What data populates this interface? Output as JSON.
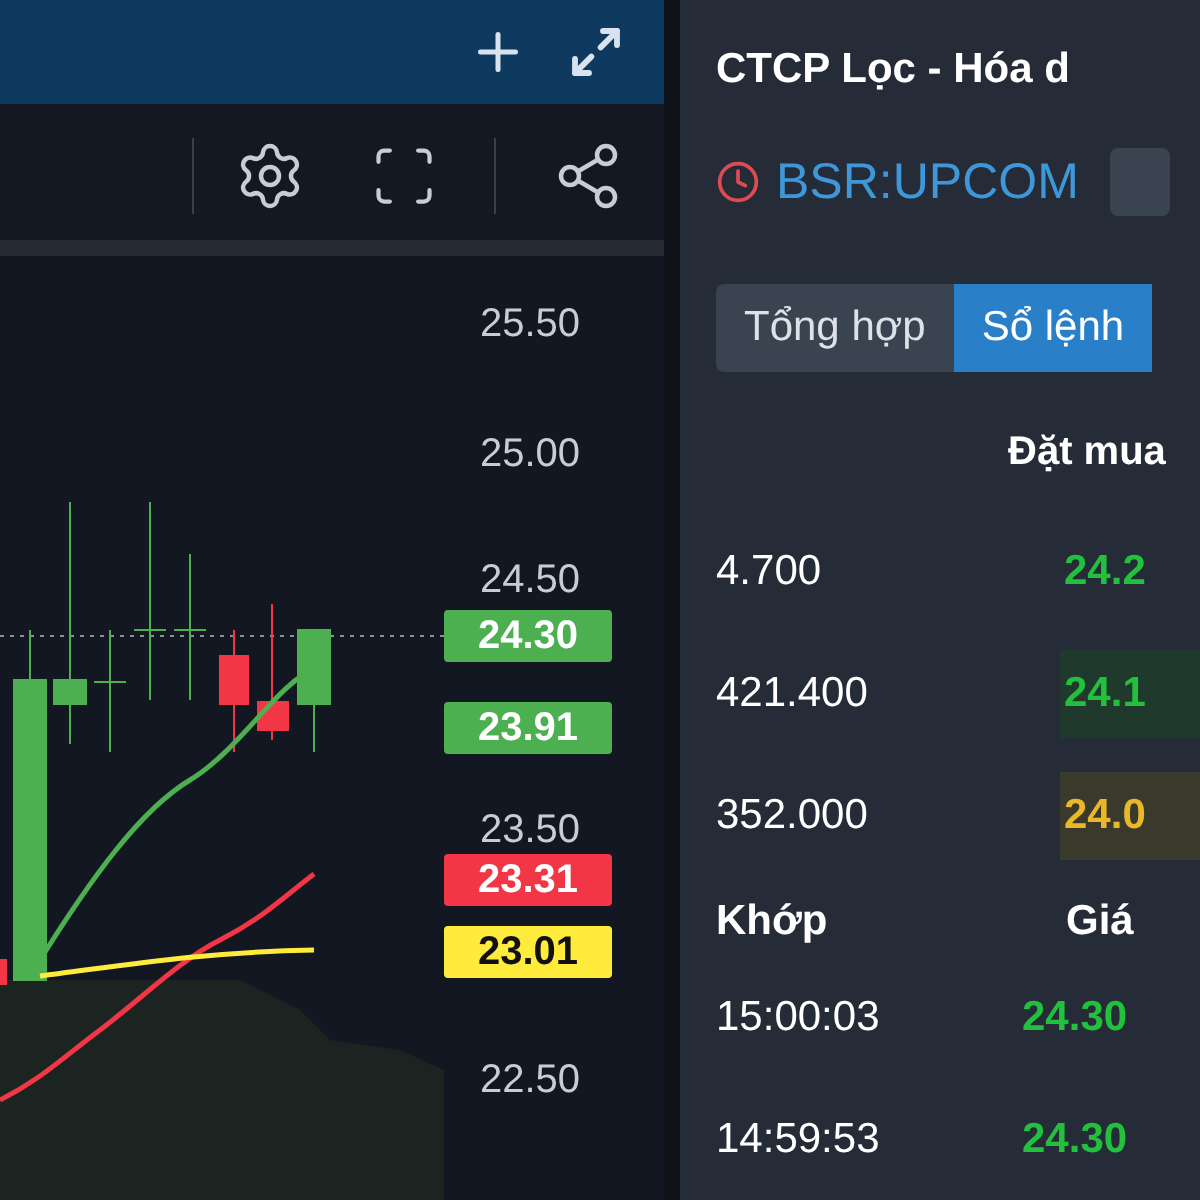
{
  "chart": {
    "axis_labels": [
      {
        "label": "25.50"
      },
      {
        "label": "25.00"
      },
      {
        "label": "24.50"
      },
      {
        "label": "23.50"
      },
      {
        "label": "22.50"
      }
    ],
    "price_tags": [
      {
        "label": "24.30",
        "color": "#4caf50"
      },
      {
        "label": "23.91",
        "color": "#4caf50"
      },
      {
        "label": "23.31",
        "color": "#f23645"
      },
      {
        "label": "23.01",
        "color": "#ffeb3b"
      }
    ]
  },
  "stock": {
    "title": "CTCP Lọc - Hóa d",
    "ticker": "BSR:UPCOM"
  },
  "tabs": [
    {
      "label": "Tổng hợp",
      "selected": false
    },
    {
      "label": "Sổ lệnh",
      "selected": true
    }
  ],
  "order_book": {
    "header": "Đặt mua",
    "rows": [
      {
        "volume": "4.700",
        "price": "24.2",
        "kind": "up",
        "highlight": false
      },
      {
        "volume": "421.400",
        "price": "24.1",
        "kind": "up",
        "highlight": true
      },
      {
        "volume": "352.000",
        "price": "24.0",
        "kind": "ref",
        "highlight": true
      }
    ]
  },
  "trades": {
    "columns": [
      "Khớp",
      "Giá"
    ],
    "rows": [
      {
        "time": "15:00:03",
        "price": "24.30"
      },
      {
        "time": "14:59:53",
        "price": "24.30"
      }
    ]
  }
}
